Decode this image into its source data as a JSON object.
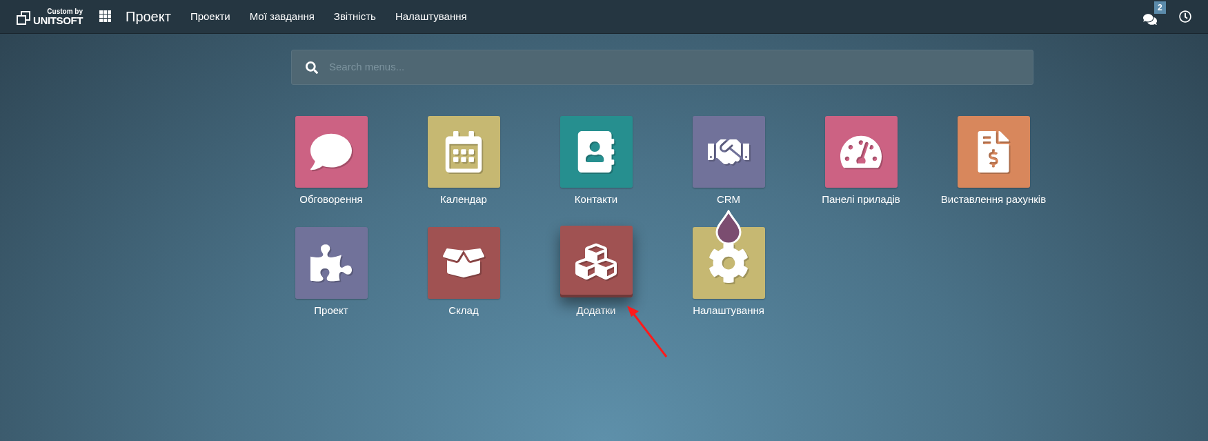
{
  "navbar": {
    "logo": {
      "tagline": "Custom by",
      "name": "UNITSOFT"
    },
    "app_title": "Проект",
    "menu": [
      "Проекти",
      "Мої завдання",
      "Звітність",
      "Налаштування"
    ],
    "chat_badge": "2"
  },
  "search": {
    "placeholder": "Search menus..."
  },
  "apps": [
    {
      "label": "Обговорення",
      "kind": "discuss",
      "color": "#cc6283",
      "selected": false,
      "badge": false
    },
    {
      "label": "Календар",
      "kind": "calendar",
      "color": "#c6b872",
      "selected": false,
      "badge": false
    },
    {
      "label": "Контакти",
      "kind": "contacts",
      "color": "#268f8f",
      "selected": false,
      "badge": false
    },
    {
      "label": "CRM",
      "kind": "crm",
      "color": "#71729a",
      "selected": false,
      "badge": false
    },
    {
      "label": "Панелі приладів",
      "kind": "dashboards",
      "color": "#cc6283",
      "selected": false,
      "badge": false
    },
    {
      "label": "Виставлення рахунків",
      "kind": "invoicing",
      "color": "#d8875c",
      "selected": false,
      "badge": false
    },
    {
      "label": "Проект",
      "kind": "project",
      "color": "#71729a",
      "selected": false,
      "badge": false
    },
    {
      "label": "Склад",
      "kind": "inventory",
      "color": "#a05252",
      "selected": false,
      "badge": false
    },
    {
      "label": "Додатки",
      "kind": "apps",
      "color": "#a05252",
      "selected": true,
      "badge": false
    },
    {
      "label": "Налаштування",
      "kind": "settings",
      "color": "#c6b872",
      "selected": false,
      "badge": true
    }
  ]
}
